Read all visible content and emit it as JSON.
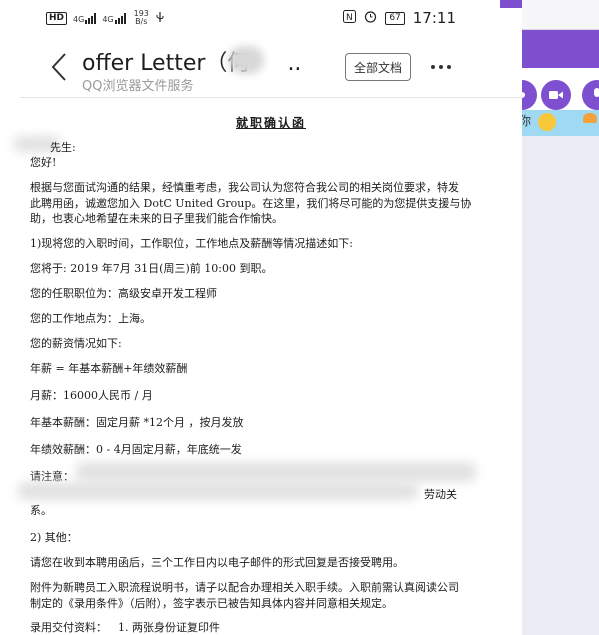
{
  "status_bar": {
    "hd_label": "HD",
    "net1": "4G",
    "net2": "4G",
    "speed_value": "193",
    "speed_unit": "B/s",
    "usb_icon": "usb-icon",
    "battery": "67",
    "time": "17:11"
  },
  "header": {
    "title": "offer Letter（何",
    "title_ellipsis": "..",
    "subtitle": "QQ浏览器文件服务",
    "all_docs_label": "全部文档",
    "back_icon": "chevron-left-icon",
    "more_icon": "more-icon"
  },
  "document": {
    "title": "就职确认函",
    "greeting_name_suffix": "先生:",
    "hello": "您好!",
    "p1_line1": "根据与您面试沟通的结果，经慎重考虑，我公司认为您符合我公司的相关岗位要求，特发",
    "p1_line2": "此聘用函，诚邀您加入 DotC United Group。在这里，我们将尽可能的为您提供支援与协",
    "p1_line3": "助，也衷心地希望在未来的日子里我们能合作愉快。",
    "section1": "1)现将您的入职时间，工作职位，工作地点及薪酬等情况描述如下:",
    "start_date": "您将于:  2019 年7月 31日(周三)前 10:00 到职。",
    "position": "您的任职职位为：高级安卓开发工程师",
    "location": "您的工作地点为：上海。",
    "salary_intro": "您的薪资情况如下:",
    "annual": "年薪 = 年基本薪酬+年绩效薪酬",
    "monthly": "月薪：16000人民币 / 月",
    "annual_base": "年基本薪酬：固定月薪 *12个月 ，按月发放",
    "annual_perf": "年绩效薪酬：0 - 4月固定月薪，年底统一发",
    "note_label": "请注意：",
    "note_end": "劳动关",
    "note_end2": "系。",
    "section2": "2) 其他：",
    "reply": "请您在收到本聘用函后，三个工作日内以电子邮件的形式回复是否接受聘用。",
    "attach_line1": "附件为新聘员工入职流程说明书，请子以配合办理相关入职手续。入职前需认真阅读公司",
    "attach_line2": "制定的《录用条件》（后附），签字表示已被告知具体内容并同意相关规定。",
    "materials_label": "录用交付资料：",
    "materials_item1": "1. 两张身份证复印件"
  },
  "background_app": {
    "chat_snippet": "你",
    "icons": [
      "phone-icon",
      "video-icon",
      "mic-icon"
    ]
  },
  "colors": {
    "accent_purple": "#7e4fcf",
    "chat_blue": "#9fd9f3"
  }
}
